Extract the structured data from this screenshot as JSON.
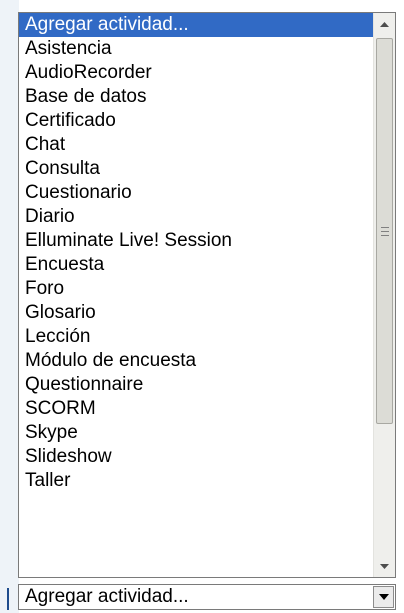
{
  "dropdown": {
    "items": [
      {
        "label": "Agregar actividad...",
        "selected": true
      },
      {
        "label": "Asistencia"
      },
      {
        "label": "AudioRecorder"
      },
      {
        "label": "Base de datos"
      },
      {
        "label": "Certificado"
      },
      {
        "label": "Chat"
      },
      {
        "label": "Consulta"
      },
      {
        "label": "Cuestionario"
      },
      {
        "label": "Diario"
      },
      {
        "label": "Elluminate Live! Session"
      },
      {
        "label": "Encuesta"
      },
      {
        "label": "Foro"
      },
      {
        "label": "Glosario"
      },
      {
        "label": "Lección"
      },
      {
        "label": "Módulo de encuesta"
      },
      {
        "label": "Questionnaire"
      },
      {
        "label": "SCORM"
      },
      {
        "label": "Skype"
      },
      {
        "label": "Slideshow"
      },
      {
        "label": "Taller"
      }
    ],
    "scrollbar": {
      "up_icon": "chevron-up-icon",
      "down_icon": "chevron-down-icon",
      "grip_icon": "grip-icon"
    }
  },
  "combo": {
    "value": "Agregar actividad...",
    "button_icon": "dropdown-arrow-icon"
  },
  "colors": {
    "selection": "#316ac5",
    "scrollbar_track": "#efefec",
    "border": "#7a7a7a"
  }
}
